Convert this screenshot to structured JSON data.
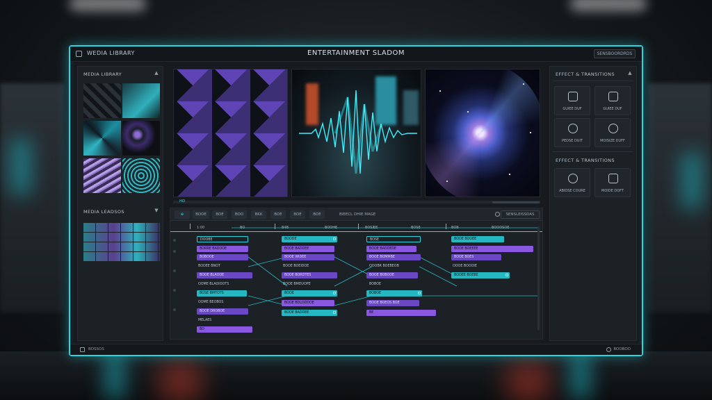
{
  "app": {
    "name": "WEDIA LIBRARY",
    "window_title": "ENTERTAINMENT SLADOM",
    "title_button": "SENSBOORDRDS"
  },
  "left_panel": {
    "section1_title": "MEDIA LIBRARY",
    "section2_title": "MEDIA LEADSOS"
  },
  "preview": {
    "badge": "HD"
  },
  "timeline": {
    "tabs": [
      "⊕",
      "BOOE",
      "BOE",
      "BOO",
      "BKK",
      "BOE",
      "BOE",
      "BOE"
    ],
    "search": "BIEECL DHIE MAGE",
    "right_button": "SENSLEISSDAS",
    "ruler_labels": [
      "1:00",
      "BO",
      "B4B",
      "BOOHE",
      "BOSIEE",
      "BOSE",
      "BOB",
      "BOOOSOE",
      "BDSIE"
    ],
    "track_labels": [
      "BOOEE BNOT",
      "OOME BLAOIOOTS",
      "OOME BEOBOS",
      "MELAES"
    ],
    "column_a": [
      "DOOBE",
      "BORRE BADOOE",
      "BOBOOE",
      "BOOE BLAOOE",
      "BOSE BMTOTS",
      "BOOE DROBOE",
      "BOOE",
      "BO"
    ],
    "column_b": [
      "BOODE",
      "BOOE BADDEE",
      "BOOE BOEIDOE",
      "BOOE WIDEE",
      "BOOE BORDTES",
      "BOOE BMDUOPE",
      "BOOE BDLODDOE",
      "BOOE"
    ],
    "column_c": [
      "BOSE",
      "BOOE BADDEDE",
      "BOOE BOMMBE",
      "OOOBR BOEBEOB",
      "BOOE BOBOOE",
      "BOBOE",
      "BOOE BOEOS BOE",
      "BE"
    ],
    "column_d": [
      "BOOE BOOEE",
      "BOOE BOEEEE",
      "BOOE BOES",
      "OOOE BOOOIE",
      "BOOEE BOEBE"
    ]
  },
  "right_panel": {
    "section1_title": "EFFECT & TRANSITIONS",
    "section2_title": "EFFECT & TRANSITIONS",
    "tiles1": [
      "GUIEE DUF",
      "GUIEE DUF",
      "PEDSE DUIT",
      "MOISIZE DUFF"
    ],
    "tiles2": [
      "ABIDSE COURE",
      "MOIDE DOFT"
    ]
  },
  "status": {
    "left": "BOSSOS",
    "right": "BOOBOO"
  },
  "colors": {
    "accent": "#2bd6e0",
    "clip_cyan": "#25b8c2",
    "clip_purple": "#8a58e0",
    "clip_violet": "#6a48c4",
    "panel_bg": "#1c2126"
  },
  "icons": {
    "title_logo": "app-logo-icon",
    "timeline_tool": "settings-icon",
    "status_left": "folder-icon",
    "status_right": "gear-icon"
  }
}
